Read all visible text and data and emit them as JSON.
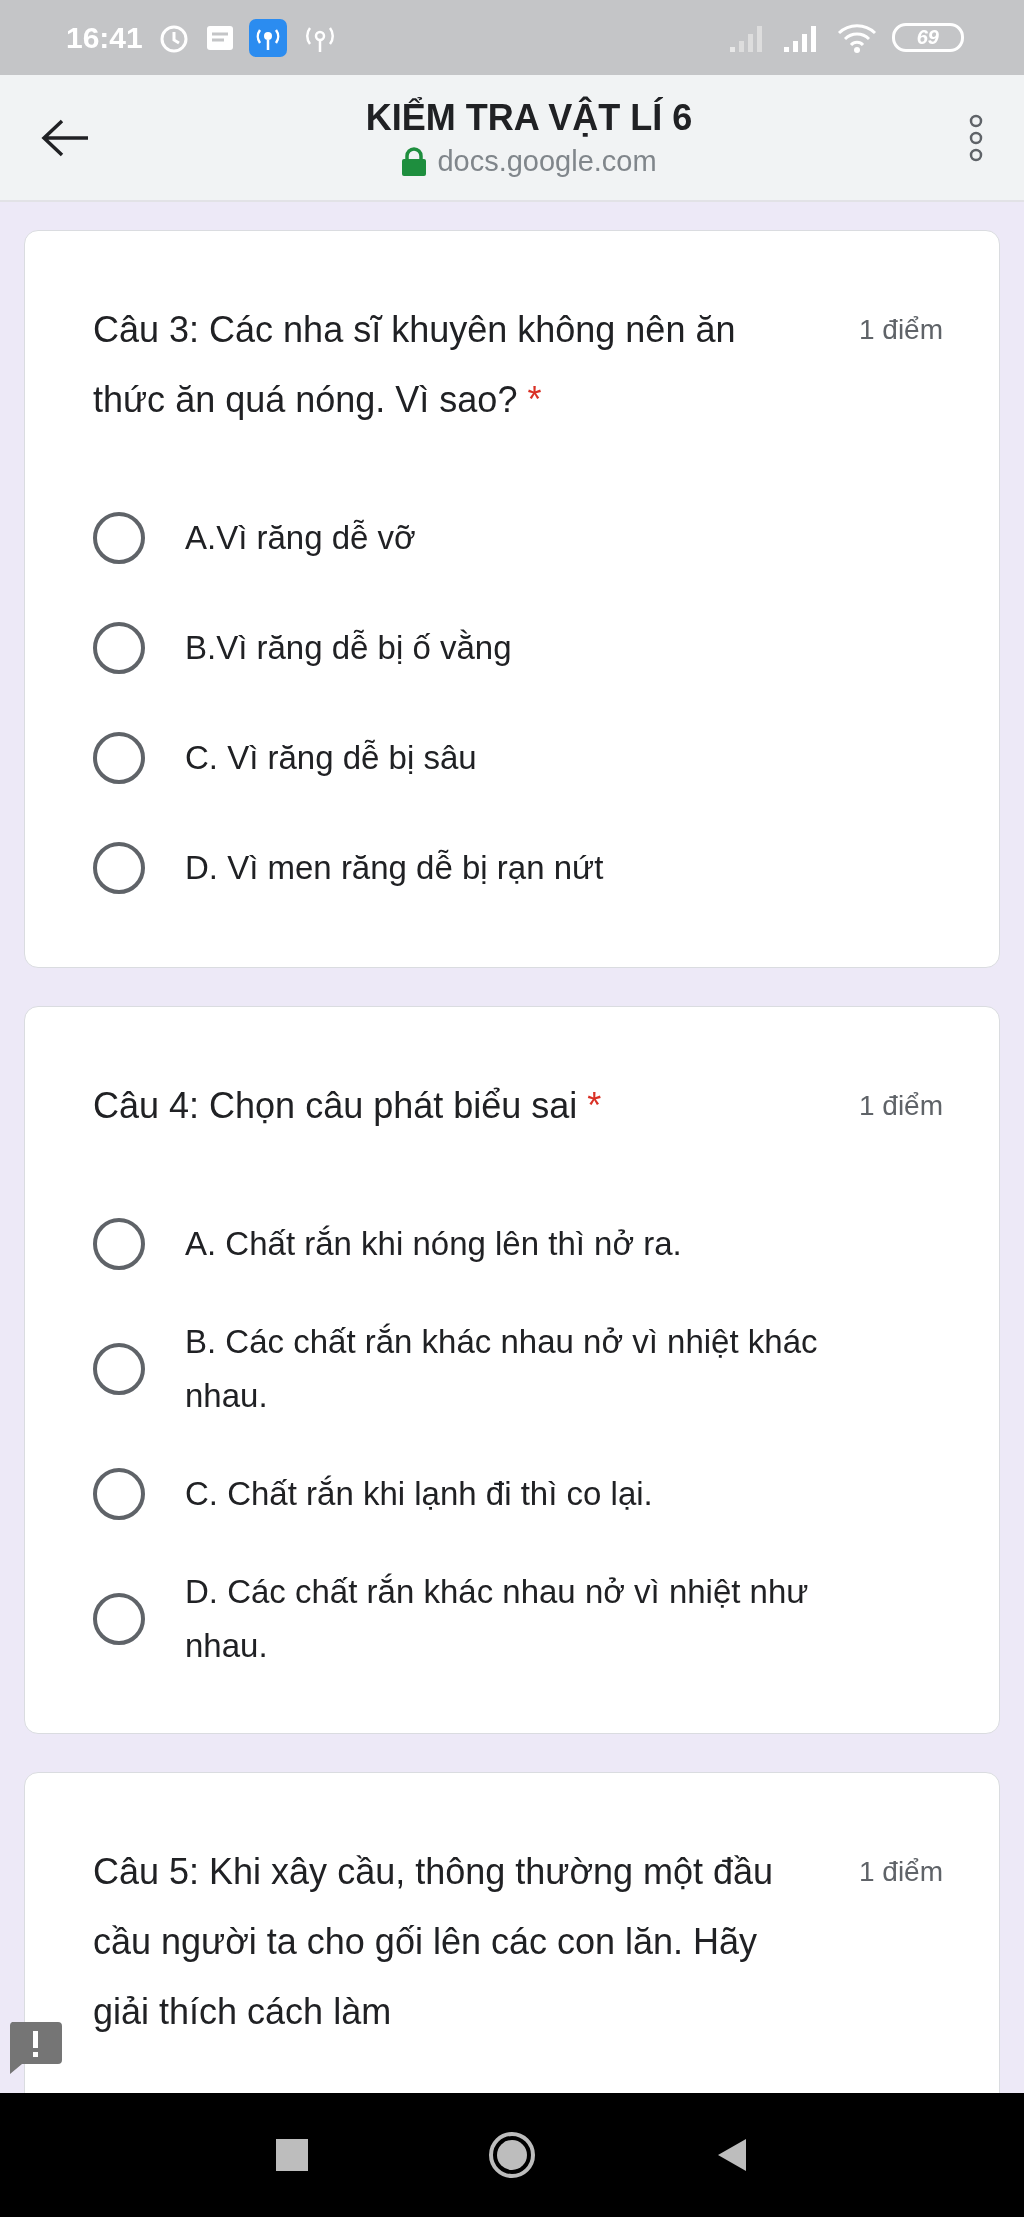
{
  "status_bar": {
    "time": "16:41",
    "battery": "69"
  },
  "header": {
    "title": "KIỂM TRA VẬT LÍ 6",
    "url": "docs.google.com"
  },
  "questions": [
    {
      "title": "Câu 3: Các nha sĩ khuyên không nên ăn thức ăn quá nóng. Vì sao?",
      "required_mark": "*",
      "points": "1 điểm",
      "options": [
        {
          "label": "A.Vì răng dễ vỡ",
          "selected": false
        },
        {
          "label": "B.Vì răng dễ bị ố vằng",
          "selected": false
        },
        {
          "label": "C. Vì răng dễ bị sâu",
          "selected": false
        },
        {
          "label": "D. Vì men răng dễ bị rạn nứt",
          "selected": false
        }
      ]
    },
    {
      "title": "Câu 4: Chọn câu phát biểu sai",
      "required_mark": "*",
      "points": "1 điểm",
      "options": [
        {
          "label": "A. Chất rắn khi nóng lên thì nở ra.",
          "selected": false
        },
        {
          "label": "B. Các chất rắn khác nhau nở vì nhiệt khác nhau.",
          "selected": false
        },
        {
          "label": "C. Chất rắn khi lạnh đi thì co lại.",
          "selected": false
        },
        {
          "label": "D. Các chất rắn khác nhau nở vì nhiệt như nhau.",
          "selected": false
        }
      ]
    },
    {
      "title": "Câu 5: Khi xây cầu, thông thường một đầu cầu người ta cho gối lên các con lăn. Hãy giải thích cách làm",
      "points": "1 điểm"
    }
  ]
}
